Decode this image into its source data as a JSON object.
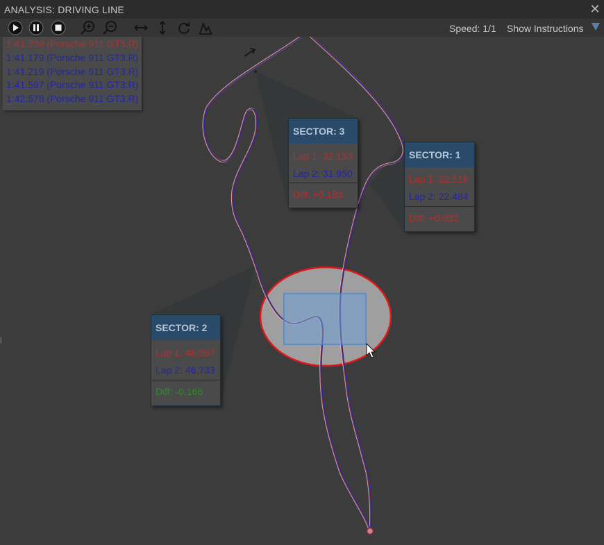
{
  "window": {
    "title": "ANALYSIS: DRIVING LINE",
    "close_icon": "close-icon"
  },
  "toolbar": {
    "buttons": [
      {
        "name": "play-icon"
      },
      {
        "name": "pause-icon"
      },
      {
        "name": "stop-icon"
      },
      {
        "name": "zoom-in-icon"
      },
      {
        "name": "zoom-out-icon"
      },
      {
        "name": "fit-horizontal-icon"
      },
      {
        "name": "fit-vertical-icon"
      },
      {
        "name": "rotate-icon"
      },
      {
        "name": "graph-icon"
      }
    ],
    "speed": "Speed: 1/1",
    "instructions": "Show Instructions"
  },
  "laps": [
    {
      "label": "1:41.239 (Porsche 911 GT3.R)",
      "color": "#b03030"
    },
    {
      "label": "1:41.179 (Porsche 911 GT3.R)",
      "color": "#2424a8"
    },
    {
      "label": "1:41.219 (Porsche 911 GT3.R)",
      "color": "#2424a8"
    },
    {
      "label": "1:41.597 (Porsche 911 GT3.R)",
      "color": "#2424a8"
    },
    {
      "label": "1:42.578 (Porsche 911 GT3.R)",
      "color": "#2424a8"
    }
  ],
  "sectors": {
    "s3": {
      "title": "SECTOR: 3",
      "lap1": "Lap 1: 32.133",
      "lap2": "Lap 2: 31.950",
      "diff": "Diff: +0.183"
    },
    "s1": {
      "title": "SECTOR: 1",
      "lap1": "Lap 1: 22.516",
      "lap2": "Lap 2: 22.484",
      "diff": "Diff: +0.032"
    },
    "s2": {
      "title": "SECTOR: 2",
      "lap1": "Lap 1: 46.567",
      "lap2": "Lap 2: 46.733",
      "diff": "Diff: -0.166"
    }
  },
  "colors": {
    "lap1": "#b03030",
    "lap2": "#2424a8",
    "diff_positive": "#b03030",
    "diff_negative": "#2e8a2e",
    "highlight_ring": "#e01818",
    "selection": "#6f9fd8"
  },
  "icons": {
    "direction": "direction-arrow-icon",
    "cursor": "mouse-cursor-icon"
  }
}
